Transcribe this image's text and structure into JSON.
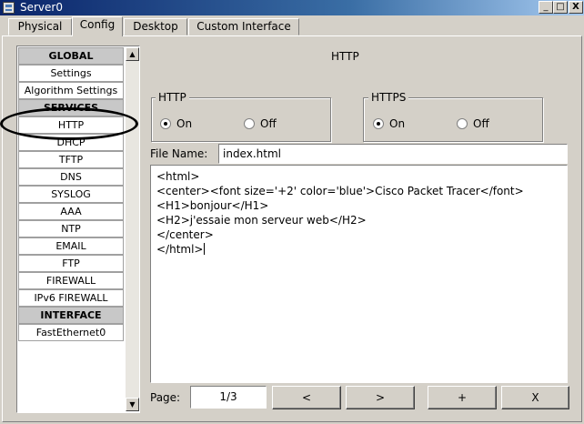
{
  "window": {
    "title": "Server0",
    "minimize": "_",
    "maximize": "□",
    "close": "X"
  },
  "tabs": [
    {
      "label": "Physical"
    },
    {
      "label": "Config"
    },
    {
      "label": "Desktop"
    },
    {
      "label": "Custom Interface"
    }
  ],
  "active_tab": "Config",
  "sidebar": {
    "items": [
      {
        "label": "GLOBAL",
        "header": true
      },
      {
        "label": "Settings"
      },
      {
        "label": "Algorithm Settings"
      },
      {
        "label": "SERVICES",
        "header": true
      },
      {
        "label": "HTTP",
        "selected": true
      },
      {
        "label": "DHCP"
      },
      {
        "label": "TFTP"
      },
      {
        "label": "DNS"
      },
      {
        "label": "SYSLOG"
      },
      {
        "label": "AAA"
      },
      {
        "label": "NTP"
      },
      {
        "label": "EMAIL"
      },
      {
        "label": "FTP"
      },
      {
        "label": "FIREWALL"
      },
      {
        "label": "IPv6 FIREWALL"
      },
      {
        "label": "INTERFACE",
        "header": true
      },
      {
        "label": "FastEthernet0"
      }
    ],
    "scroll_up": "▲",
    "scroll_down": "▼"
  },
  "main": {
    "title": "HTTP",
    "http": {
      "label": "HTTP",
      "on_label": "On",
      "off_label": "Off",
      "selected": "On"
    },
    "https": {
      "label": "HTTPS",
      "on_label": "On",
      "off_label": "Off",
      "selected": "On"
    },
    "file_name_label": "File Name:",
    "file_name_value": "index.html",
    "editor_content": "<html>\n<center><font size='+2' color='blue'>Cisco Packet Tracer</font>\n<H1>bonjour</H1>\n<H2>j'essaie mon serveur web</H2>\n</center>\n</html>",
    "page_label": "Page:",
    "page_value": "1/3",
    "buttons": {
      "prev": "<",
      "next": ">",
      "add": "+",
      "delete": "X"
    }
  },
  "colors": {
    "face": "#d4d0c8",
    "titlebar": "#0a246a",
    "annotation": "#000000"
  }
}
